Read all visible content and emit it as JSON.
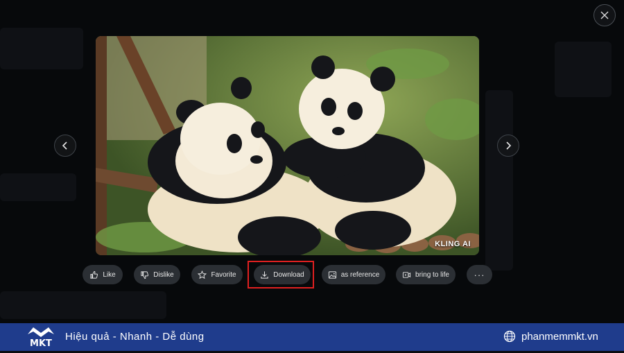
{
  "viewer": {
    "close_icon": "close-icon",
    "prev_icon": "chevron-left-icon",
    "next_icon": "chevron-right-icon",
    "watermark": "KLING AI"
  },
  "actions": {
    "like": "Like",
    "dislike": "Dislike",
    "favorite": "Favorite",
    "download": "Download",
    "as_reference": "as reference",
    "bring_to_life": "bring to life",
    "more": "···"
  },
  "banner": {
    "slogan": "Hiệu quả - Nhanh - Dễ dùng",
    "website": "phanmemmkt.vn",
    "logo_text": "MKT",
    "color": "#1f3c8c"
  },
  "highlight_color": "#e02020"
}
